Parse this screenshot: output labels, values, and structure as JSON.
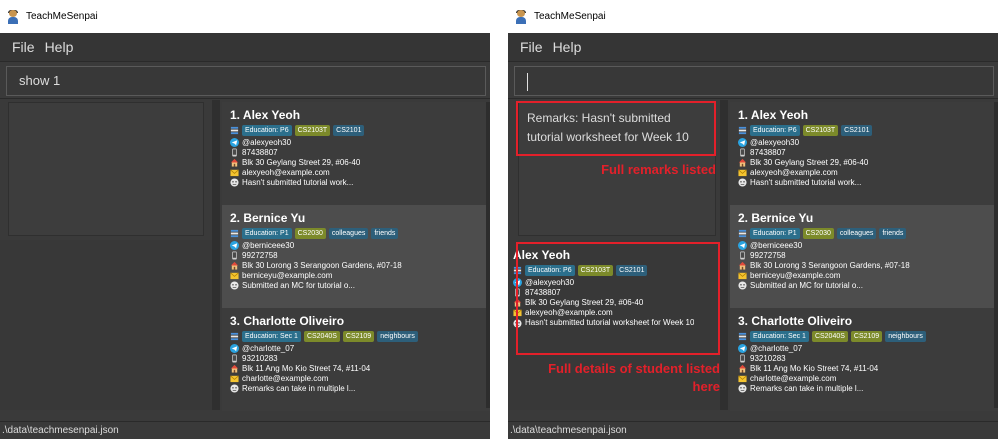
{
  "app": {
    "title": "TeachMeSenpai"
  },
  "menu": {
    "file": "File",
    "help": "Help"
  },
  "left": {
    "command_value": "show 1",
    "status_path": ".\\data\\teachmesenpai.json"
  },
  "right": {
    "command_value": "",
    "result_text": "Remarks: Hasn't submitted tutorial worksheet for Week 10",
    "status_path": ".\\data\\teachmesenpai.json",
    "annotation_remarks": "Full remarks listed",
    "annotation_details": "Full details of student listed here",
    "detail": {
      "name": "Alex Yeoh",
      "education": "Education: P6",
      "modules": [
        "CS2103T",
        "CS2101"
      ],
      "telegram": "@alexyeoh30",
      "phone": "87438807",
      "address": "Blk 30 Geylang Street 29, #06-40",
      "email": "alexyeoh@example.com",
      "remark": "Hasn't submitted tutorial worksheet for Week 10"
    }
  },
  "students": [
    {
      "index_name": "1.  Alex Yeoh",
      "education": "Education: P6",
      "tags": [
        {
          "label": "CS2103T",
          "kind": "mod"
        },
        {
          "label": "CS2101",
          "kind": "grp"
        }
      ],
      "telegram": "@alexyeoh30",
      "phone": "87438807",
      "address": "Blk 30 Geylang Street 29, #06-40",
      "email": "alexyeoh@example.com",
      "remark": "Hasn't submitted tutorial work..."
    },
    {
      "index_name": "2.  Bernice Yu",
      "education": "Education: P1",
      "tags": [
        {
          "label": "CS2030",
          "kind": "mod"
        },
        {
          "label": "colleagues",
          "kind": "grp"
        },
        {
          "label": "friends",
          "kind": "grp"
        }
      ],
      "telegram": "@berniceee30",
      "phone": "99272758",
      "address": "Blk 30 Lorong 3 Serangoon Gardens, #07-18",
      "email": "berniceyu@example.com",
      "remark": "Submitted an MC for tutorial o..."
    },
    {
      "index_name": "3.  Charlotte Oliveiro",
      "education": "Education: Sec 1",
      "tags": [
        {
          "label": "CS2040S",
          "kind": "mod"
        },
        {
          "label": "CS2109",
          "kind": "mod"
        },
        {
          "label": "neighbours",
          "kind": "grp"
        }
      ],
      "telegram": "@charlotte_07",
      "phone": "93210283",
      "address": "Blk 11 Ang Mo Kio Street 74, #11-04",
      "email": "charlotte@example.com",
      "remark": "Remarks can take in multiple l..."
    }
  ],
  "colors": {
    "annotation": "#e3202a",
    "edu_tag": "#2b6f8c",
    "module_tag": "#7c8a2a"
  }
}
